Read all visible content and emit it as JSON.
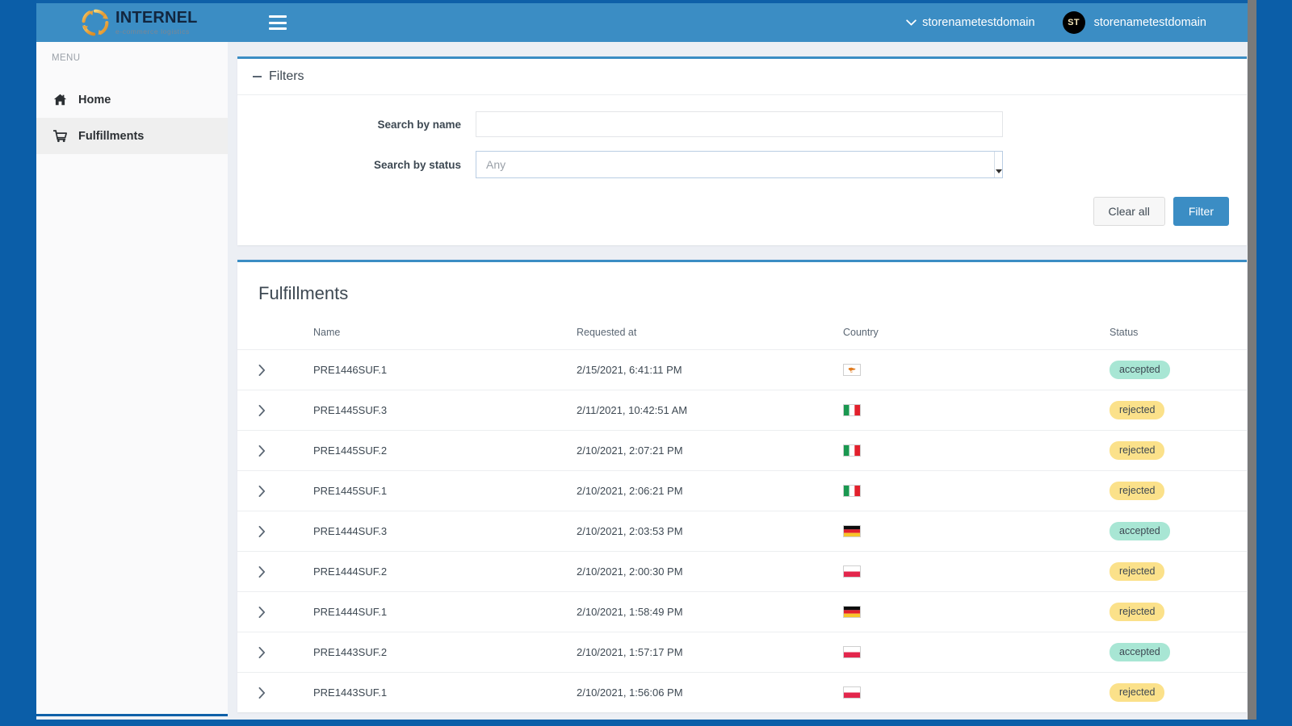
{
  "brand": {
    "name": "INTERNEL",
    "tagline": "e-commerce logistics",
    "logo_icon": "circular-arrows-icon",
    "accent_blue": "#3b8dc4",
    "page_blue": "#0b5ea8"
  },
  "topbar": {
    "menu_toggle_icon": "hamburger-icon",
    "store_switcher": {
      "label": "storenametestdomain",
      "icon": "chevron-down-icon"
    },
    "user": {
      "initials": "ST",
      "name": "storenametestdomain"
    }
  },
  "sidebar": {
    "caption": "MENU",
    "items": [
      {
        "label": "Home",
        "icon": "home-icon",
        "active": false
      },
      {
        "label": "Fulfillments",
        "icon": "cart-icon",
        "active": true
      }
    ]
  },
  "filters": {
    "title": "Filters",
    "collapse_icon": "minus-icon",
    "fields": [
      {
        "label": "Search by name",
        "value": "",
        "placeholder": "",
        "type": "text"
      },
      {
        "label": "Search by status",
        "value": "Any",
        "type": "select"
      }
    ],
    "buttons": {
      "clear": "Clear all",
      "filter": "Filter"
    }
  },
  "list": {
    "title": "Fulfillments",
    "columns": [
      "",
      "Name",
      "Requested at",
      "Country",
      "Status"
    ],
    "expand_icon": "chevron-right-icon",
    "rows": [
      {
        "name": "PRE1446SUF.1",
        "requested_at": "2/15/2021, 6:41:11 PM",
        "country": "CY",
        "country_name": "Cyprus",
        "status": "accepted"
      },
      {
        "name": "PRE1445SUF.3",
        "requested_at": "2/11/2021, 10:42:51 AM",
        "country": "IT",
        "country_name": "Italy",
        "status": "rejected"
      },
      {
        "name": "PRE1445SUF.2",
        "requested_at": "2/10/2021, 2:07:21 PM",
        "country": "IT",
        "country_name": "Italy",
        "status": "rejected"
      },
      {
        "name": "PRE1445SUF.1",
        "requested_at": "2/10/2021, 2:06:21 PM",
        "country": "IT",
        "country_name": "Italy",
        "status": "rejected"
      },
      {
        "name": "PRE1444SUF.3",
        "requested_at": "2/10/2021, 2:03:53 PM",
        "country": "DE",
        "country_name": "Germany",
        "status": "accepted"
      },
      {
        "name": "PRE1444SUF.2",
        "requested_at": "2/10/2021, 2:00:30 PM",
        "country": "PL",
        "country_name": "Poland",
        "status": "rejected"
      },
      {
        "name": "PRE1444SUF.1",
        "requested_at": "2/10/2021, 1:58:49 PM",
        "country": "DE",
        "country_name": "Germany",
        "status": "rejected"
      },
      {
        "name": "PRE1443SUF.2",
        "requested_at": "2/10/2021, 1:57:17 PM",
        "country": "PL",
        "country_name": "Poland",
        "status": "accepted"
      },
      {
        "name": "PRE1443SUF.1",
        "requested_at": "2/10/2021, 1:56:06 PM",
        "country": "PL",
        "country_name": "Poland",
        "status": "rejected"
      }
    ]
  },
  "status_colors": {
    "accepted": "#a8e6d4",
    "rejected": "#fbe18a"
  }
}
